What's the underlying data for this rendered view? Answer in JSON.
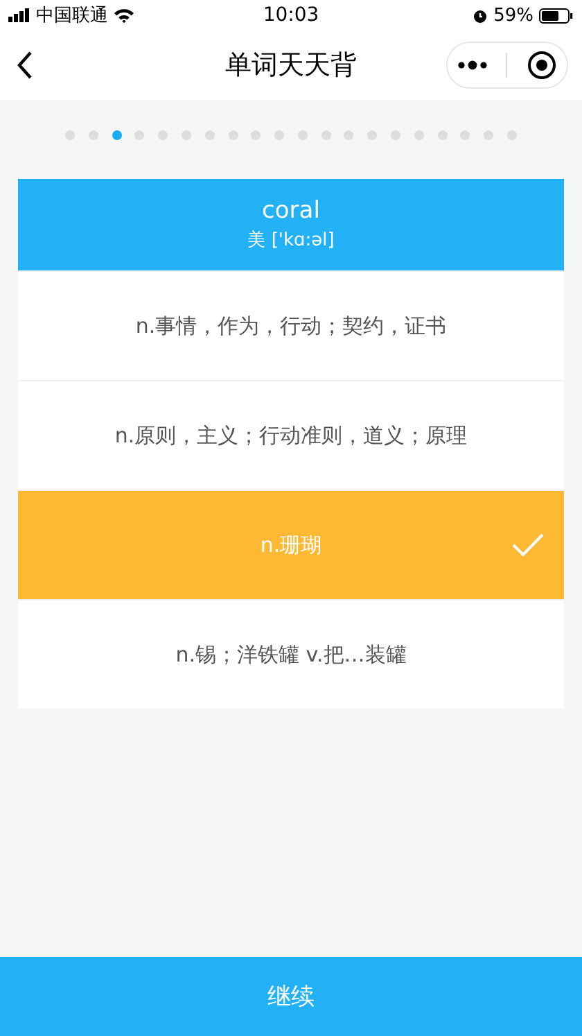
{
  "status_bar": {
    "carrier": "中国联通",
    "time": "10:03",
    "battery": "59%"
  },
  "nav": {
    "title": "单词天天背"
  },
  "progress": [
    {
      "selected": false
    },
    {
      "selected": false
    },
    {
      "selected": true
    },
    {
      "selected": false
    },
    {
      "selected": false
    },
    {
      "selected": false
    },
    {
      "selected": false
    },
    {
      "selected": false
    },
    {
      "selected": false
    },
    {
      "selected": false
    },
    {
      "selected": false
    },
    {
      "selected": false
    },
    {
      "selected": false
    },
    {
      "selected": false
    },
    {
      "selected": false
    },
    {
      "selected": false
    },
    {
      "selected": false
    },
    {
      "selected": false
    },
    {
      "selected": false
    },
    {
      "selected": false
    }
  ],
  "word": {
    "text": "coral",
    "phonetic": "美 ['kɑ:əl]"
  },
  "options": [
    {
      "text": "n.事情，作为，行动；契约，证书",
      "selected": false
    },
    {
      "text": "n.原则，主义；行动准则，道义；原理",
      "selected": false
    },
    {
      "text": "n.珊瑚",
      "selected": true
    },
    {
      "text": "n.锡；洋铁罐 v.把…装罐",
      "selected": false
    }
  ],
  "continue_button": "继续"
}
